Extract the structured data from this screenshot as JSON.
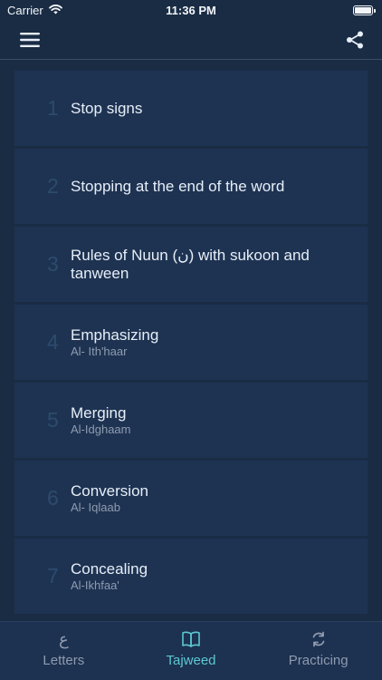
{
  "status_bar": {
    "carrier": "Carrier",
    "time": "11:36 PM"
  },
  "nav": {
    "menu_icon": "hamburger-menu-icon",
    "share_icon": "share-icon"
  },
  "lessons": [
    {
      "number": "1",
      "title": "Stop signs",
      "subtitle": ""
    },
    {
      "number": "2",
      "title": "Stopping at the end of the word",
      "subtitle": ""
    },
    {
      "number": "3",
      "title": "Rules of Nuun (ن) with sukoon and tanween",
      "subtitle": ""
    },
    {
      "number": "4",
      "title": "Emphasizing",
      "subtitle": "Al- Ith'haar"
    },
    {
      "number": "5",
      "title": "Merging",
      "subtitle": "Al-Idghaam"
    },
    {
      "number": "6",
      "title": "Conversion",
      "subtitle": "Al- Iqlaab"
    },
    {
      "number": "7",
      "title": "Concealing",
      "subtitle": "Al-Ikhfaa'"
    }
  ],
  "tabs": [
    {
      "label": "Letters",
      "icon_glyph": "ع",
      "icon": "arabic-letter-icon",
      "active": false
    },
    {
      "label": "Tajweed",
      "icon": "book-icon",
      "active": true
    },
    {
      "label": "Practicing",
      "icon": "refresh-icon",
      "active": false
    }
  ],
  "colors": {
    "background": "#1a2c44",
    "card": "#1e3352",
    "accent": "#5cc9d2",
    "tab_inactive": "#8e9bb0"
  }
}
